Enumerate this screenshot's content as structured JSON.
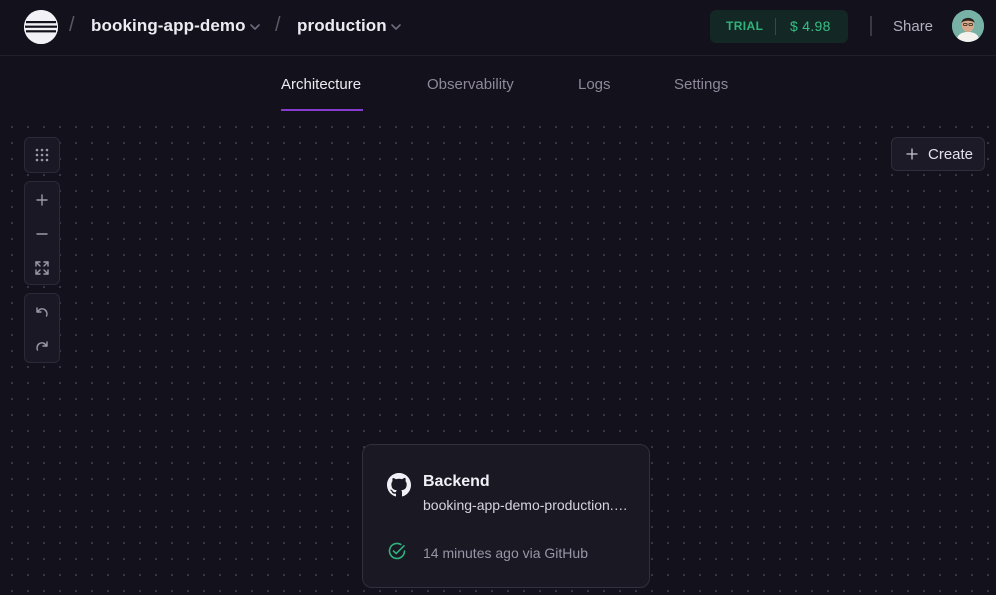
{
  "header": {
    "project_name": "booking-app-demo",
    "environment_name": "production",
    "plan_badge": "TRIAL",
    "credit_amount": "$ 4.98",
    "share_label": "Share",
    "separator": "/"
  },
  "tabs": [
    {
      "label": "Architecture",
      "active": true
    },
    {
      "label": "Observability",
      "active": false
    },
    {
      "label": "Logs",
      "active": false
    },
    {
      "label": "Settings",
      "active": false
    }
  ],
  "canvas": {
    "create_label": "Create",
    "controls": [
      "grid-dots-icon",
      "zoom-in-icon",
      "zoom-out-icon",
      "fit-view-icon",
      "undo-icon",
      "redo-icon"
    ]
  },
  "service_card": {
    "name": "Backend",
    "domain": "booking-app-demo-production.up.railway.app",
    "status": "14 minutes ago via GitHub",
    "source_icon": "github-icon",
    "status_icon": "check-circle-icon"
  },
  "colors": {
    "background": "#13111c",
    "accent_purple": "#853bce",
    "success_green": "#2fb37c"
  }
}
